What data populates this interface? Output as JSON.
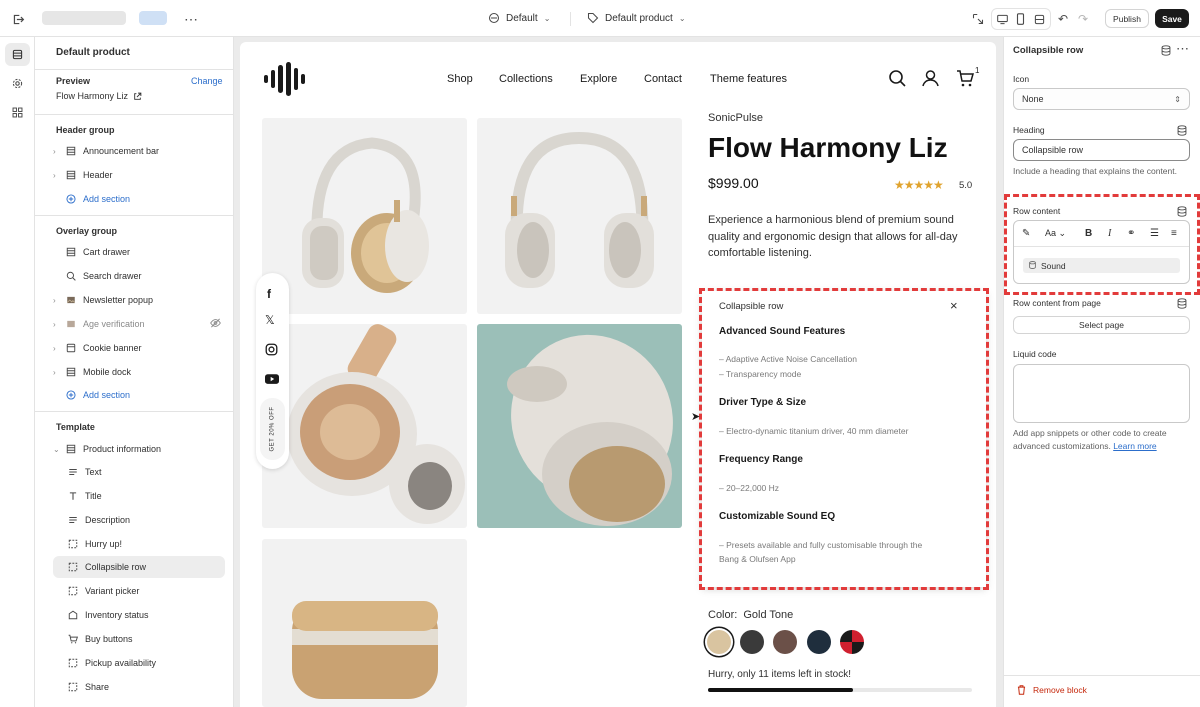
{
  "topbar": {
    "theme_label": "Default",
    "template_label": "Default product",
    "publish_label": "Publish",
    "save_label": "Save"
  },
  "left": {
    "title": "Default product",
    "preview_label": "Preview",
    "preview_change": "Change",
    "preview_product": "Flow Harmony Liz",
    "header_group": "Header group",
    "header_items": [
      {
        "label": "Announcement bar",
        "icon": "section-icon"
      },
      {
        "label": "Header",
        "icon": "section-icon"
      }
    ],
    "add_section": "Add section",
    "overlay_group": "Overlay group",
    "overlay_items": [
      {
        "label": "Cart drawer"
      },
      {
        "label": "Search drawer"
      },
      {
        "label": "Newsletter popup"
      },
      {
        "label": "Age verification"
      },
      {
        "label": "Cookie banner"
      },
      {
        "label": "Mobile dock"
      }
    ],
    "template_group": "Template",
    "template_section": "Product information",
    "blocks": [
      {
        "label": "Text"
      },
      {
        "label": "Title"
      },
      {
        "label": "Description"
      },
      {
        "label": "Hurry up!"
      },
      {
        "label": "Collapsible row"
      },
      {
        "label": "Variant picker"
      },
      {
        "label": "Inventory status"
      },
      {
        "label": "Buy buttons"
      },
      {
        "label": "Pickup availability"
      },
      {
        "label": "Share"
      }
    ]
  },
  "store": {
    "nav": [
      "Shop",
      "Collections",
      "Explore",
      "Contact",
      "Theme features"
    ],
    "cart_count": "1",
    "vendor": "SonicPulse",
    "product_title": "Flow Harmony Liz",
    "price": "$999.00",
    "rating": "5.0",
    "stars": "★★★★★",
    "description": "Experience a harmonious blend of premium sound quality and ergonomic design that allows for all-day comfortable listening.",
    "social_tab": "GET 20% OFF",
    "color_label": "Color:",
    "color_value": "Gold Tone",
    "swatch_colors": [
      "#d9c4a0",
      "#3a3a3a",
      "#6b5048",
      "#1f2e3d",
      "#d0202f"
    ],
    "stock_text": "Hurry, only 11 items left in stock!",
    "stock_fraction": 0.55
  },
  "popup": {
    "title": "Collapsible row",
    "sections": [
      {
        "heading": "Advanced Sound Features",
        "lines": [
          "– Adaptive Active Noise Cancellation",
          "– Transparency mode"
        ]
      },
      {
        "heading": "Driver Type & Size",
        "lines": [
          "– Electro-dynamic titanium driver, 40 mm diameter"
        ]
      },
      {
        "heading": "Frequency Range",
        "lines": [
          "– 20–22,000 Hz"
        ]
      },
      {
        "heading": "Customizable Sound EQ",
        "lines": [
          "– Presets available and fully customisable through the",
          "Bang & Olufsen App"
        ]
      }
    ]
  },
  "right": {
    "title": "Collapsible row",
    "icon_label": "Icon",
    "icon_value": "None",
    "heading_label": "Heading",
    "heading_value": "Collapsible row",
    "heading_hint": "Include a heading that explains the content.",
    "row_content_label": "Row content",
    "row_content_value": "Sound",
    "row_from_page_label": "Row content from page",
    "select_page": "Select page",
    "liquid_label": "Liquid code",
    "liquid_hint": "Add app snippets or other code to create advanced customizations.",
    "learn_more": "Learn more",
    "remove_block": "Remove block"
  }
}
